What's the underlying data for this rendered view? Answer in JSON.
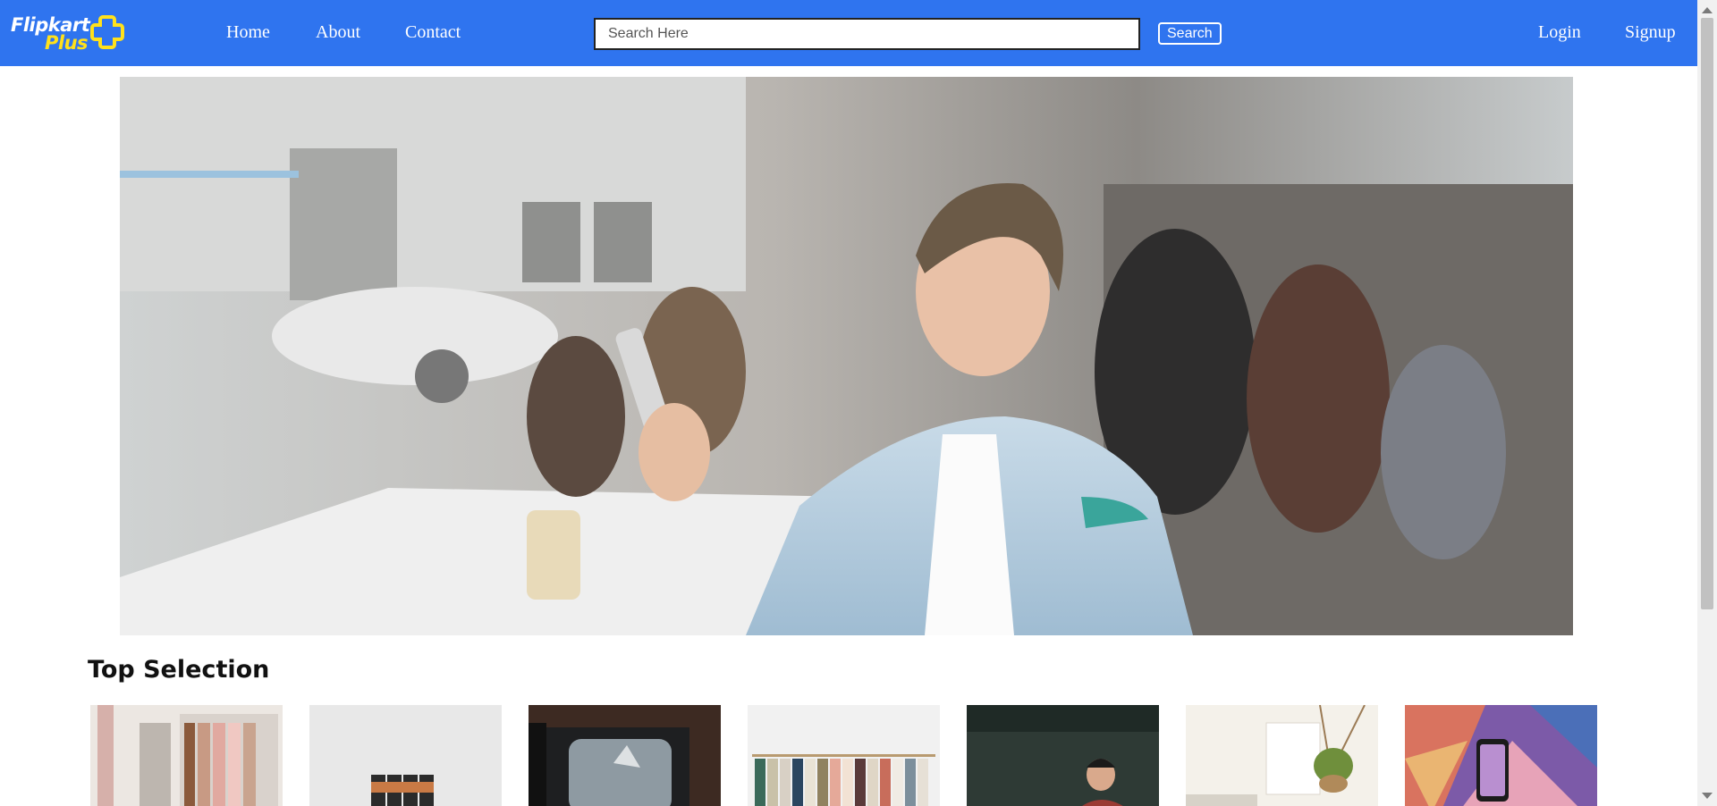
{
  "brand": {
    "name_line1": "Flipkart",
    "name_line2": "Plus",
    "primary_color": "#2f74ef",
    "accent_color": "#ffe11b"
  },
  "nav": {
    "links": [
      "Home",
      "About",
      "Contact"
    ],
    "login_label": "Login",
    "signup_label": "Signup"
  },
  "search": {
    "placeholder": "Search Here",
    "button_label": "Search"
  },
  "hero": {
    "image_icon": "hero-photo-man-with-phone-icon"
  },
  "top_selection": {
    "title": "Top Selection",
    "items": [
      {
        "image_icon": "clothing-rack-room-icon"
      },
      {
        "image_icon": "batteries-icon"
      },
      {
        "image_icon": "retro-tv-icon"
      },
      {
        "image_icon": "clothing-rail-icon"
      },
      {
        "image_icon": "person-dark-room-icon"
      },
      {
        "image_icon": "living-room-plant-icon"
      },
      {
        "image_icon": "phone-colorful-background-icon"
      }
    ]
  }
}
